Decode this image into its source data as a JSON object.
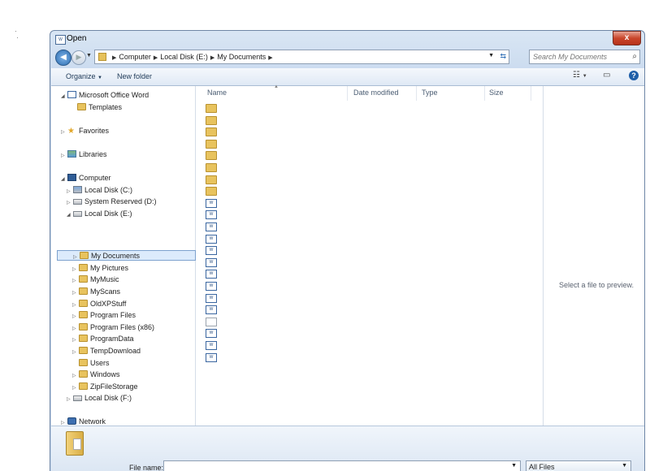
{
  "window": {
    "title": "Open",
    "close_glyph": "x"
  },
  "address": {
    "crumbs": [
      "Computer",
      "Local Disk (E:)",
      "My Documents"
    ],
    "search_placeholder": "Search My Documents"
  },
  "toolbar": {
    "organize": "Organize",
    "new_folder": "New folder"
  },
  "nav": {
    "items": [
      {
        "label": "Microsoft Office Word",
        "icon": "word-icon"
      },
      {
        "label": "Templates",
        "icon": "folder-icon"
      },
      {
        "label": "Favorites",
        "icon": "star-icon"
      },
      {
        "label": "Libraries",
        "icon": "library-icon"
      },
      {
        "label": "Computer",
        "icon": "computer-icon"
      },
      {
        "label": "Local Disk (C:)",
        "icon": "drive-icon"
      },
      {
        "label": "System Reserved (D:)",
        "icon": "drive-icon"
      },
      {
        "label": "Local Disk (E:)",
        "icon": "drive-icon"
      },
      {
        "label": "My Documents",
        "icon": "folder-icon",
        "selected": true
      },
      {
        "label": "My Pictures",
        "icon": "folder-icon"
      },
      {
        "label": "MyMusic",
        "icon": "folder-icon"
      },
      {
        "label": "MyScans",
        "icon": "folder-icon"
      },
      {
        "label": "OldXPStuff",
        "icon": "folder-icon"
      },
      {
        "label": "Program Files",
        "icon": "folder-icon"
      },
      {
        "label": "Program Files (x86)",
        "icon": "folder-icon"
      },
      {
        "label": "ProgramData",
        "icon": "folder-icon"
      },
      {
        "label": "TempDownload",
        "icon": "folder-icon"
      },
      {
        "label": "Users",
        "icon": "folder-icon"
      },
      {
        "label": "Windows",
        "icon": "folder-icon"
      },
      {
        "label": "ZipFileStorage",
        "icon": "folder-icon"
      },
      {
        "label": "Local Disk (F:)",
        "icon": "drive-icon"
      },
      {
        "label": "Network",
        "icon": "network-icon"
      }
    ]
  },
  "columns": {
    "name": "Name",
    "date_modified": "Date modified",
    "type": "Type",
    "size": "Size"
  },
  "files": [
    "folder",
    "folder",
    "folder",
    "folder",
    "folder",
    "folder",
    "folder",
    "folder",
    "doc",
    "doc",
    "doc",
    "doc",
    "doc",
    "doc",
    "doc",
    "doc",
    "doc",
    "doc",
    "plain",
    "doc",
    "doc",
    "doc"
  ],
  "preview": {
    "text": "Select a file to preview."
  },
  "footer": {
    "file_name_label": "File name:",
    "file_name_value": "",
    "filter": "All Files"
  }
}
